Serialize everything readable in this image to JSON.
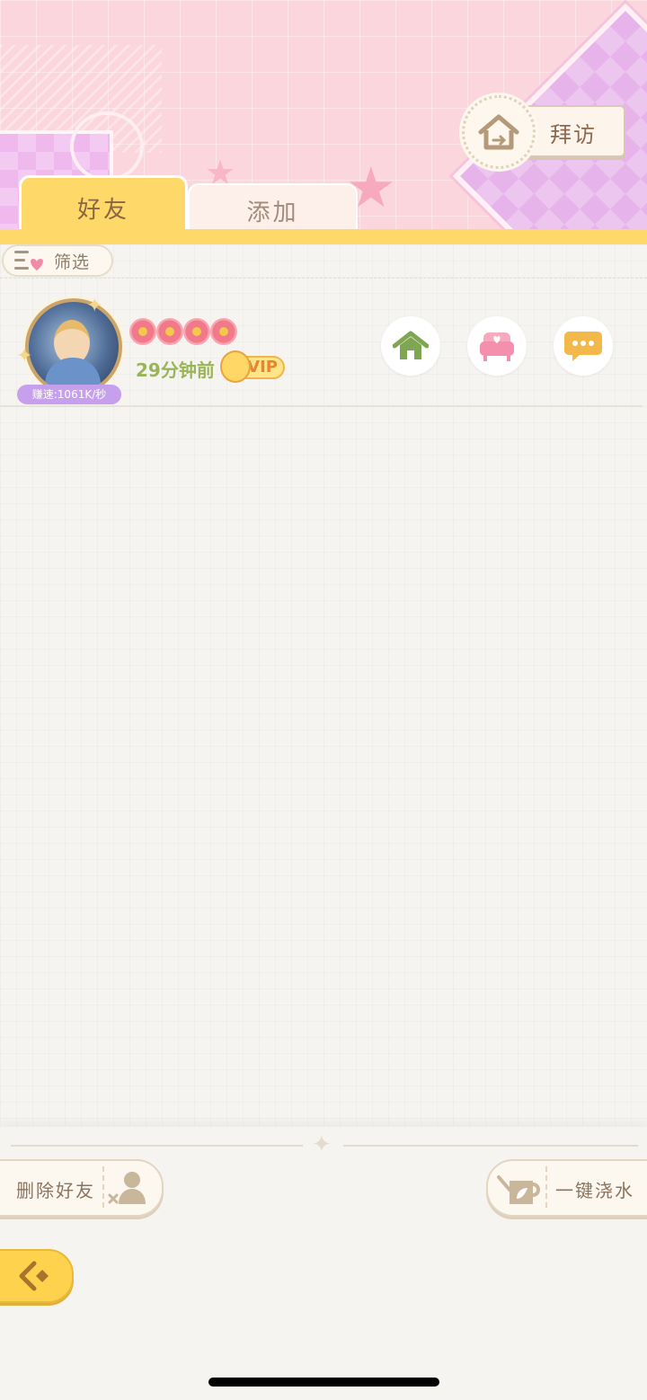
{
  "header": {
    "visit_button_label": "拜访"
  },
  "tabs": [
    {
      "label": "好友",
      "active": true
    },
    {
      "label": "添加",
      "active": false
    }
  ],
  "filter": {
    "label": "筛选"
  },
  "friend": {
    "speed_badge": "赚速:1061K/秒",
    "flowers_count": 4,
    "last_online": "29分钟前",
    "vip_label": "VIP",
    "actions": [
      "home-icon",
      "sofa-icon",
      "chat-icon"
    ]
  },
  "bottom": {
    "delete_label": "删除好友",
    "water_label": "一键浇水"
  },
  "colors": {
    "accent_yellow": "#ffd86a",
    "header_pink": "#fbd6dc",
    "text_brown": "#8a7460",
    "online_green": "#9ab45a"
  }
}
